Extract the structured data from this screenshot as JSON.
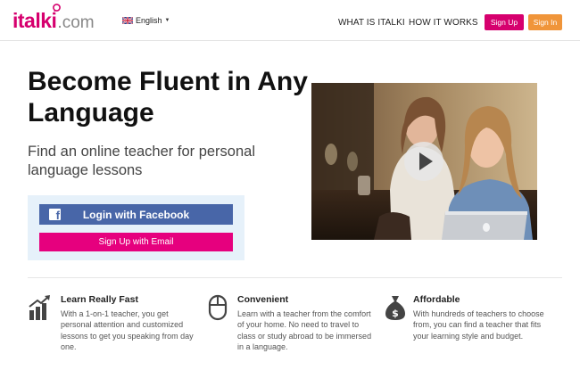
{
  "header": {
    "logo_main": "italki",
    "logo_suffix": ".com",
    "language": "English",
    "nav": [
      "WHAT IS ITALKI",
      "HOW IT WORKS"
    ],
    "signup_label": "Sign Up",
    "signin_label": "Sign In"
  },
  "hero": {
    "title": "Become Fluent in Any Language",
    "subtitle": "Find an online teacher for personal language lessons",
    "facebook_label": "Login with Facebook",
    "email_label": "Sign Up with Email",
    "video_icon": "play-icon"
  },
  "features": [
    {
      "title": "Learn Really Fast",
      "description": "With a 1-on-1 teacher, you get personal attention and customized lessons to get you speaking from day one.",
      "icon": "bar-chart-icon"
    },
    {
      "title": "Convenient",
      "description": "Learn with a teacher from the comfort of your home. No need to travel to class or study abroad to be immersed in a language.",
      "icon": "mouse-icon"
    },
    {
      "title": "Affordable",
      "description": "With hundreds of teachers to choose from, you can find a teacher that fits your learning style and budget.",
      "icon": "money-bag-icon"
    }
  ],
  "colors": {
    "brand_pink": "#d6006e",
    "signin_orange": "#f0953a",
    "facebook_blue": "#4866a8",
    "email_pink": "#e6007e",
    "cta_panel_bg": "#e6f1fa"
  }
}
